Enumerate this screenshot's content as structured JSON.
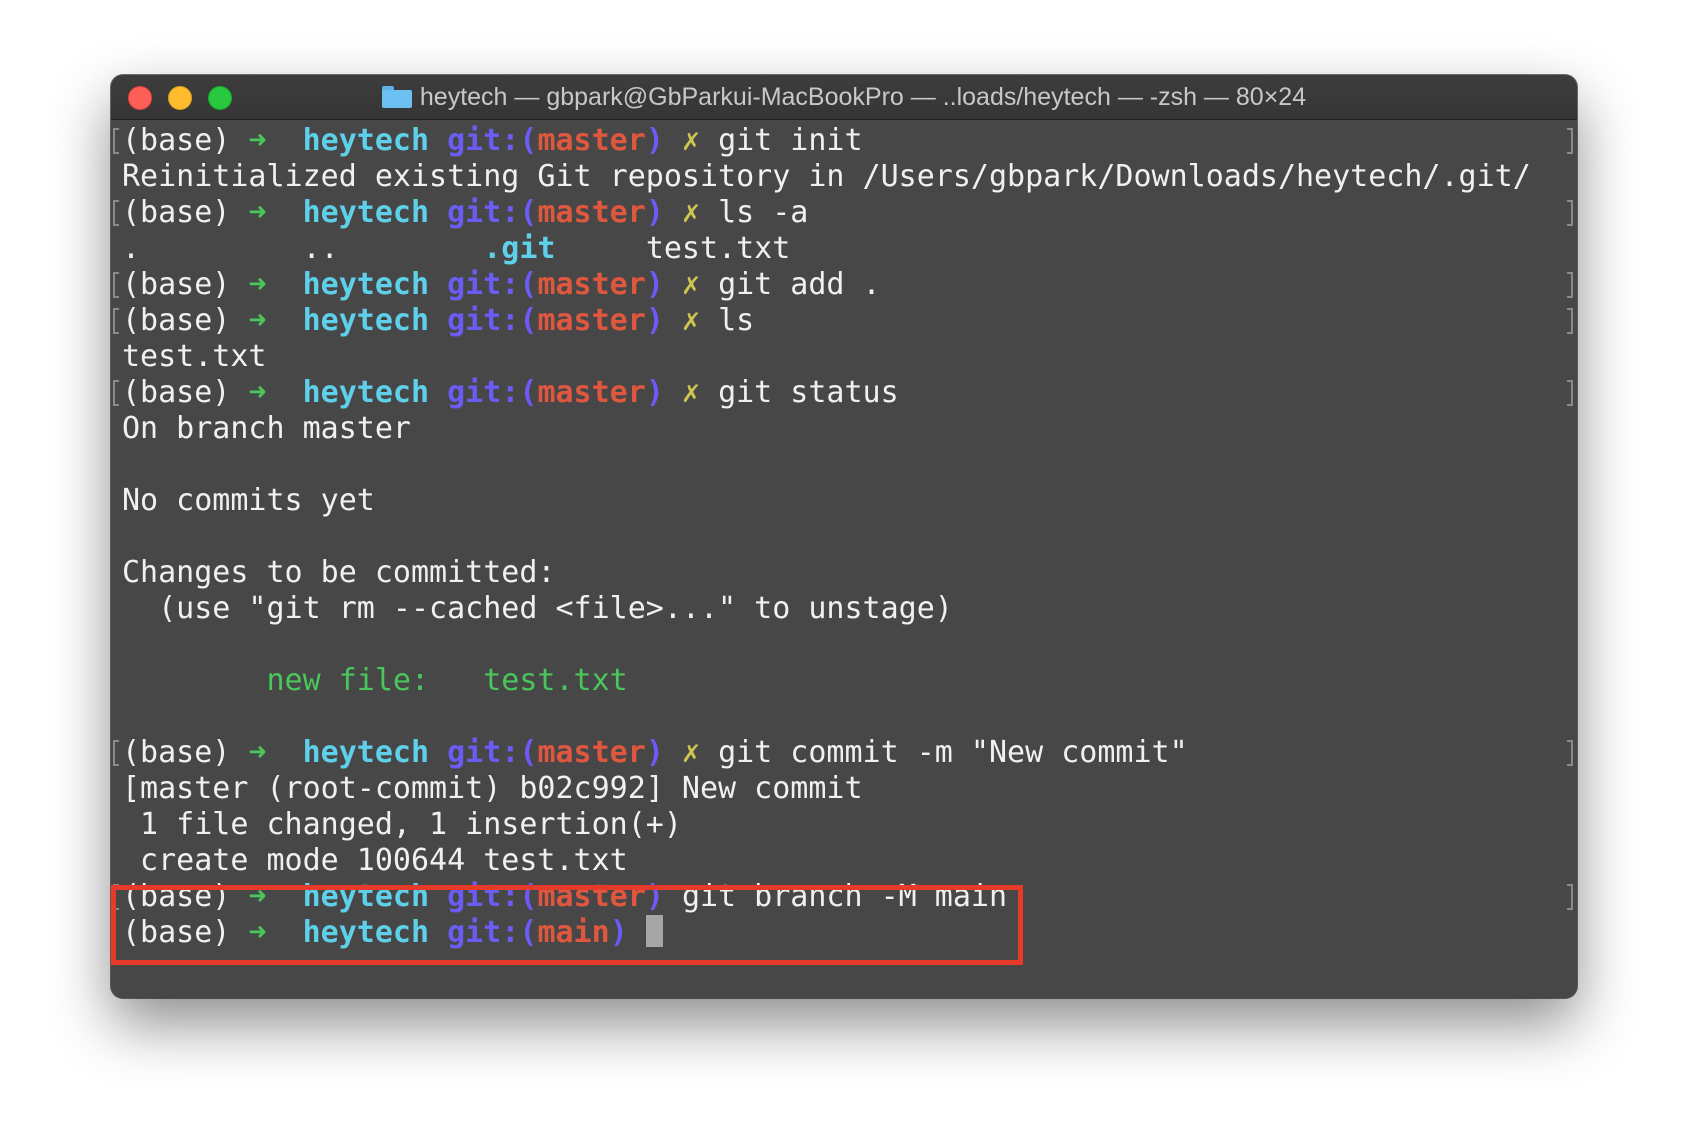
{
  "window": {
    "title": "heytech — gbpark@GbParkui-MacBookPro — ..loads/heytech — -zsh — 80×24",
    "icon": "folder-icon"
  },
  "prompt": {
    "env": "(base)",
    "arrow": "➜",
    "dir": "heytech",
    "git_open": "git:(",
    "git_close": ")",
    "dirty_mark": "✗",
    "branch_master": "master",
    "branch_main": "main"
  },
  "commands": {
    "c1": "git init",
    "c2": "ls -a",
    "c3": "git add .",
    "c4": "ls",
    "c5": "git status",
    "c6": "git commit -m \"New commit\"",
    "c7": "git branch -M main"
  },
  "output": {
    "reinit": "Reinitialized existing Git repository in /Users/gbpark/Downloads/heytech/.git/",
    "ls_a": {
      "dot": ".",
      "dotdot": "..",
      "gitdir": ".git",
      "file": "test.txt"
    },
    "ls": "test.txt",
    "status_branch": "On branch master",
    "no_commits": "No commits yet",
    "changes_header": "Changes to be committed:",
    "unstage_hint": "  (use \"git rm --cached <file>...\" to unstage)",
    "new_file_label": "        new file:",
    "new_file_name": "test.txt",
    "commit_summary": "[master (root-commit) b02c992] New commit",
    "changed": " 1 file changed, 1 insertion(+)",
    "create_mode": " create mode 100644 test.txt"
  },
  "colors": {
    "background": "#474747",
    "dir": "#5fd0ea",
    "git": "#6a5cf5",
    "branch": "#e0573f",
    "arrow": "#49c75a",
    "dirty": "#cdc551",
    "highlight": "#e83a28"
  }
}
